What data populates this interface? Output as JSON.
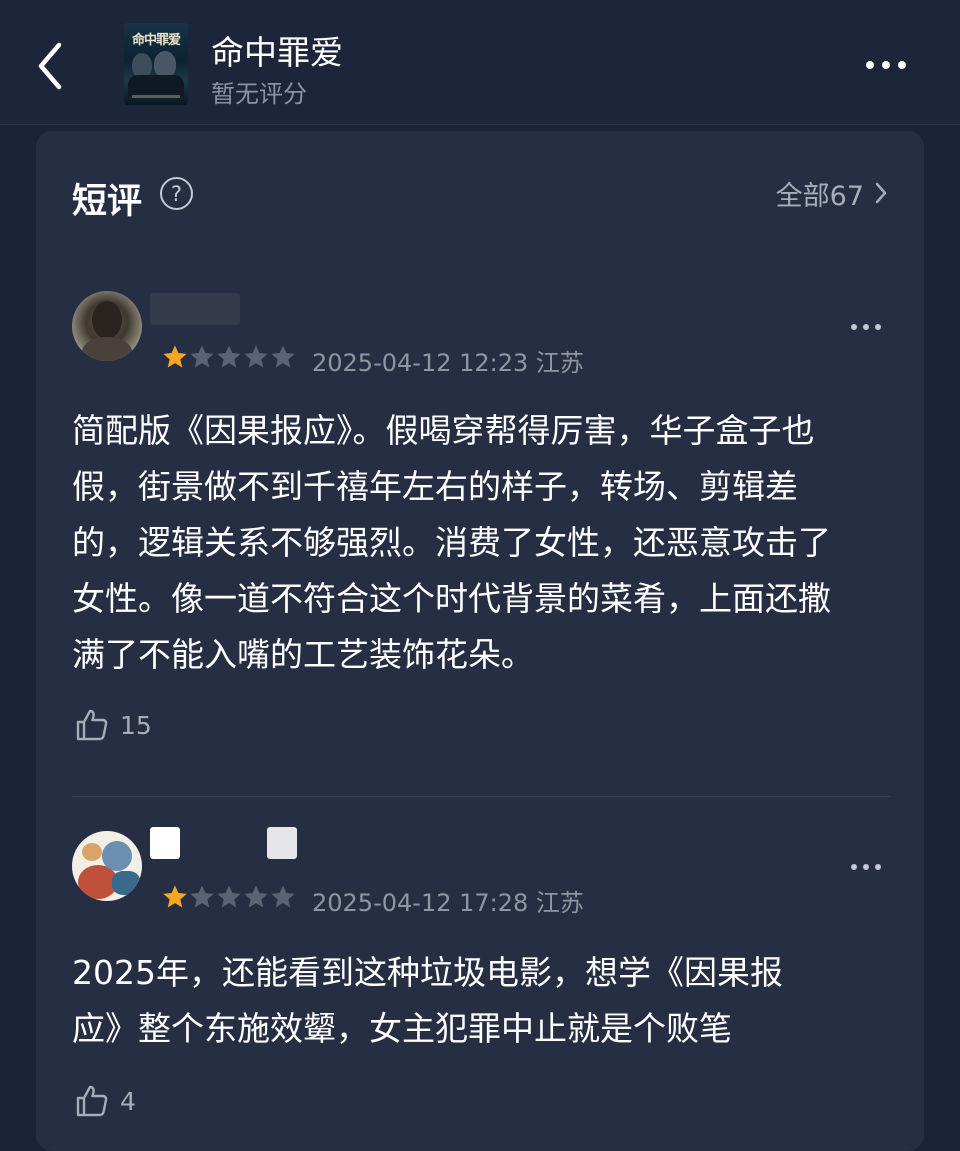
{
  "header": {
    "movie_title": "命中罪爱",
    "rating_text": "暂无评分",
    "poster_title": "命中罪爱",
    "icons": {
      "back": "chevron-left-icon",
      "more": "more-horizontal-icon"
    }
  },
  "section": {
    "title": "短评",
    "all_label": "全部67",
    "icons": {
      "help": "question-circle-icon",
      "chevron": "chevron-right-icon"
    }
  },
  "colors": {
    "background": "#1b2437",
    "card": "#252e42",
    "star_filled": "#f5a623",
    "star_empty": "#5a6274",
    "muted_text": "#8f96a3"
  },
  "reviews": [
    {
      "rating": 1,
      "max_rating": 5,
      "datetime": "2025-04-12 12:23",
      "location": "江苏",
      "lines": [
        "简配版《因果报应》。假喝穿帮得厉害，华子盒子也",
        "假，街景做不到千禧年左右的样子，转场、剪辑差",
        "的，逻辑关系不够强烈。消费了女性，还恶意攻击了",
        "女性。像一道不符合这个时代背景的菜肴，上面还撒",
        "满了不能入嘴的工艺装饰花朵。"
      ],
      "likes": "15"
    },
    {
      "rating": 1,
      "max_rating": 5,
      "datetime": "2025-04-12 17:28",
      "location": "江苏",
      "lines": [
        "2025年，还能看到这种垃圾电影，想学《因果报",
        "应》整个东施效颦，女主犯罪中止就是个败笔"
      ],
      "likes": "4"
    }
  ]
}
